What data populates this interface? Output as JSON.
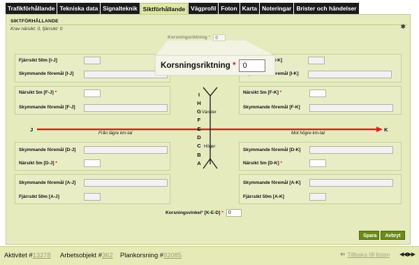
{
  "tabs": [
    "Trafikförhållande",
    "Tekniska data",
    "Signalteknik",
    "Siktförhållande",
    "Vägprofil",
    "Foton",
    "Karta",
    "Noteringar",
    "Brister och händelser"
  ],
  "section": {
    "title": "SIKTFÖRHÅLLANDE",
    "subtitle": "Krav närsikt: 0, fjärrsikt: 0"
  },
  "fields": {
    "required_mark": "*",
    "riktning": {
      "label": "Korsningsriktning",
      "value": "0"
    },
    "fjarr_ij": {
      "label": "Fjärrsikt 50m [I-J]",
      "value": ""
    },
    "sky_ij": {
      "label": "Skymmande föremål [I-J]",
      "value": ""
    },
    "nar_fj": {
      "label": "Närsikt 5m [F-J]",
      "value": ""
    },
    "sky_fj": {
      "label": "Skymmande föremål [F-J]",
      "value": ""
    },
    "fjarr_ik": {
      "label": "Fjärrsikt 50m [I-K]",
      "value": ""
    },
    "sky_ik": {
      "label": "Skymmande föremål [I-K]",
      "value": ""
    },
    "nar_fk": {
      "label": "Närsikt 5m [F-K]",
      "value": ""
    },
    "sky_fk": {
      "label": "Skymmande föremål [F-K]",
      "value": ""
    },
    "sky_dj": {
      "label": "Skymmande föremål [D-J]",
      "value": ""
    },
    "nar_dj": {
      "label": "Närsikt 5m [D-J]",
      "value": ""
    },
    "sky_aj": {
      "label": "Skymmande föremål [A-J]",
      "value": ""
    },
    "fjarr_aj": {
      "label": "Fjärrsikt 50m [A-J]",
      "value": ""
    },
    "sky_dk": {
      "label": "Skymmande föremål [D-K]",
      "value": ""
    },
    "nar_dk": {
      "label": "Närsikt 5m [D-K]",
      "value": ""
    },
    "sky_ak": {
      "label": "Skymmande föremål [A-K]",
      "value": ""
    },
    "fjarr_ak": {
      "label": "Fjärrsikt 50m [A-K]",
      "value": ""
    },
    "vinkel": {
      "label": "Korsningsvinkel° [K-E-D]",
      "value": "0"
    }
  },
  "diagram": {
    "end_left": "J",
    "end_right": "K",
    "dir_left": "Från lägre km-tal",
    "dir_right": "Mot högre km-tal",
    "left_side": "Vänster",
    "right_side": "Höger",
    "points": [
      "I",
      "H",
      "G",
      "F",
      "E",
      "D",
      "C",
      "B",
      "A"
    ]
  },
  "buttons": {
    "save": "Spara",
    "cancel": "Avbryt"
  },
  "footer": {
    "aktivitet_label": "Aktivitet #",
    "aktivitet_id": "13278",
    "arbetsobjekt_label": "Arbetsobjekt #",
    "arbetsobjekt_id": "362",
    "plankorsning_label": "Plankorsning #",
    "plankorsning_id": "92085",
    "back": "Tillbaka till listan"
  }
}
